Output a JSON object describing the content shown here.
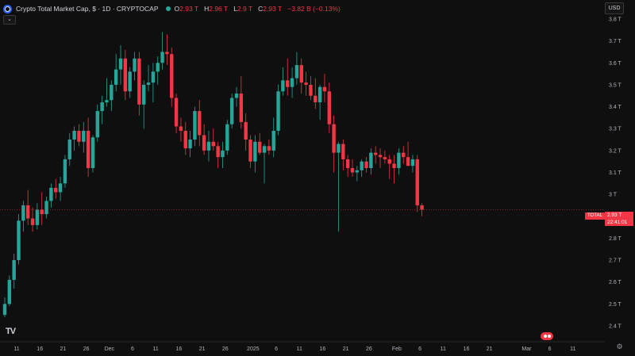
{
  "legend": {
    "symbol_title": "Crypto Total Market Cap, $ · 1D · CRYPTOCAP",
    "open_key": "O",
    "open": "2.93 T",
    "high_key": "H",
    "high": "2.96 T",
    "low_key": "L",
    "low": "2.9 T",
    "close_key": "C",
    "close": "2.93 T",
    "change": "−3.82 B (−0.13%)"
  },
  "collapse_icon": "chevron-down-icon",
  "currency": "USD",
  "price_label": {
    "symbol": "TOTAL",
    "price": "2.93 T",
    "countdown": "22:41:01"
  },
  "brand": "TV",
  "colors": {
    "up": "#26a69a",
    "down": "#f23645",
    "background": "#0f0f0f",
    "text": "#d1d4dc"
  },
  "chart_data": {
    "type": "candlestick",
    "y_ticks": [
      "3.8 T",
      "3.7 T",
      "3.6 T",
      "3.5 T",
      "3.4 T",
      "3.3 T",
      "3.2 T",
      "3.1 T",
      "3 T",
      "2.9 T",
      "2.8 T",
      "2.7 T",
      "2.6 T",
      "2.5 T",
      "2.4 T"
    ],
    "y_tick_values": [
      3.8,
      3.7,
      3.6,
      3.5,
      3.4,
      3.3,
      3.2,
      3.1,
      3.0,
      2.9,
      2.8,
      2.7,
      2.6,
      2.5,
      2.4
    ],
    "ylim": [
      2.37,
      3.84
    ],
    "x_labels": [
      "11",
      "16",
      "21",
      "26",
      "Dec",
      "6",
      "11",
      "16",
      "21",
      "26",
      "2025",
      "6",
      "11",
      "16",
      "21",
      "26",
      "Feb",
      "6",
      "11",
      "16",
      "21",
      "Mar",
      "6",
      "11"
    ],
    "x_label_day_index": [
      0,
      5,
      10,
      15,
      20,
      25,
      30,
      35,
      40,
      45,
      51,
      56,
      61,
      66,
      71,
      76,
      82,
      87,
      92,
      97,
      102,
      110,
      115,
      120
    ],
    "last_price": 2.93,
    "candles": [
      [
        2.45,
        2.53,
        2.44,
        2.5
      ],
      [
        2.5,
        2.63,
        2.49,
        2.61
      ],
      [
        2.61,
        2.73,
        2.57,
        2.7
      ],
      [
        2.7,
        2.91,
        2.68,
        2.88
      ],
      [
        2.88,
        2.97,
        2.83,
        2.95
      ],
      [
        2.95,
        3.02,
        2.86,
        2.89
      ],
      [
        2.89,
        2.94,
        2.83,
        2.86
      ],
      [
        2.86,
        2.96,
        2.84,
        2.93
      ],
      [
        2.93,
        3.01,
        2.86,
        2.91
      ],
      [
        2.91,
        2.99,
        2.89,
        2.97
      ],
      [
        2.97,
        3.05,
        2.94,
        3.03
      ],
      [
        3.03,
        3.07,
        2.98,
        3.01
      ],
      [
        3.01,
        3.08,
        2.97,
        3.05
      ],
      [
        3.05,
        3.18,
        3.03,
        3.16
      ],
      [
        3.16,
        3.28,
        3.13,
        3.25
      ],
      [
        3.25,
        3.31,
        3.2,
        3.29
      ],
      [
        3.29,
        3.32,
        3.22,
        3.24
      ],
      [
        3.24,
        3.33,
        3.19,
        3.29
      ],
      [
        3.29,
        3.35,
        3.08,
        3.12
      ],
      [
        3.12,
        3.27,
        3.1,
        3.26
      ],
      [
        3.26,
        3.41,
        3.24,
        3.38
      ],
      [
        3.38,
        3.45,
        3.32,
        3.42
      ],
      [
        3.42,
        3.53,
        3.4,
        3.43
      ],
      [
        3.43,
        3.52,
        3.38,
        3.5
      ],
      [
        3.5,
        3.64,
        3.47,
        3.57
      ],
      [
        3.57,
        3.68,
        3.5,
        3.62
      ],
      [
        3.62,
        3.66,
        3.43,
        3.47
      ],
      [
        3.47,
        3.58,
        3.44,
        3.56
      ],
      [
        3.56,
        3.65,
        3.52,
        3.62
      ],
      [
        3.62,
        3.65,
        3.36,
        3.41
      ],
      [
        3.41,
        3.52,
        3.3,
        3.5
      ],
      [
        3.5,
        3.59,
        3.47,
        3.51
      ],
      [
        3.51,
        3.6,
        3.42,
        3.56
      ],
      [
        3.56,
        3.63,
        3.5,
        3.6
      ],
      [
        3.6,
        3.74,
        3.57,
        3.65
      ],
      [
        3.65,
        3.73,
        3.59,
        3.64
      ],
      [
        3.64,
        3.67,
        3.4,
        3.44
      ],
      [
        3.44,
        3.46,
        3.28,
        3.31
      ],
      [
        3.31,
        3.35,
        3.24,
        3.29
      ],
      [
        3.29,
        3.33,
        3.18,
        3.21
      ],
      [
        3.21,
        3.29,
        3.17,
        3.25
      ],
      [
        3.25,
        3.4,
        3.22,
        3.38
      ],
      [
        3.38,
        3.43,
        3.22,
        3.27
      ],
      [
        3.27,
        3.32,
        3.18,
        3.2
      ],
      [
        3.2,
        3.29,
        3.15,
        3.24
      ],
      [
        3.24,
        3.3,
        3.2,
        3.22
      ],
      [
        3.22,
        3.24,
        3.12,
        3.17
      ],
      [
        3.17,
        3.24,
        3.12,
        3.2
      ],
      [
        3.2,
        3.34,
        3.18,
        3.32
      ],
      [
        3.32,
        3.46,
        3.3,
        3.44
      ],
      [
        3.44,
        3.49,
        3.4,
        3.46
      ],
      [
        3.46,
        3.54,
        3.3,
        3.33
      ],
      [
        3.33,
        3.37,
        3.2,
        3.25
      ],
      [
        3.25,
        3.27,
        3.12,
        3.15
      ],
      [
        3.15,
        3.27,
        3.1,
        3.24
      ],
      [
        3.24,
        3.28,
        3.18,
        3.19
      ],
      [
        3.19,
        3.23,
        3.05,
        3.22
      ],
      [
        3.22,
        3.25,
        3.18,
        3.2
      ],
      [
        3.2,
        3.35,
        3.17,
        3.29
      ],
      [
        3.29,
        3.5,
        3.27,
        3.47
      ],
      [
        3.47,
        3.58,
        3.45,
        3.52
      ],
      [
        3.52,
        3.62,
        3.45,
        3.49
      ],
      [
        3.49,
        3.58,
        3.44,
        3.53
      ],
      [
        3.53,
        3.65,
        3.5,
        3.59
      ],
      [
        3.59,
        3.62,
        3.46,
        3.51
      ],
      [
        3.51,
        3.56,
        3.45,
        3.5
      ],
      [
        3.5,
        3.54,
        3.43,
        3.45
      ],
      [
        3.45,
        3.53,
        3.39,
        3.42
      ],
      [
        3.42,
        3.5,
        3.34,
        3.49
      ],
      [
        3.49,
        3.55,
        3.42,
        3.47
      ],
      [
        3.47,
        3.51,
        3.28,
        3.32
      ],
      [
        3.32,
        3.36,
        3.1,
        3.19
      ],
      [
        3.19,
        3.24,
        2.83,
        3.23
      ],
      [
        3.23,
        3.25,
        3.11,
        3.16
      ],
      [
        3.16,
        3.18,
        3.08,
        3.12
      ],
      [
        3.12,
        3.16,
        3.08,
        3.1
      ],
      [
        3.1,
        3.13,
        3.06,
        3.11
      ],
      [
        3.11,
        3.16,
        3.08,
        3.15
      ],
      [
        3.15,
        3.17,
        3.1,
        3.12
      ],
      [
        3.12,
        3.21,
        3.09,
        3.19
      ],
      [
        3.19,
        3.22,
        3.14,
        3.18
      ],
      [
        3.18,
        3.21,
        3.12,
        3.17
      ],
      [
        3.17,
        3.2,
        3.14,
        3.16
      ],
      [
        3.16,
        3.18,
        3.07,
        3.14
      ],
      [
        3.14,
        3.18,
        3.05,
        3.12
      ],
      [
        3.12,
        3.21,
        3.09,
        3.19
      ],
      [
        3.19,
        3.22,
        3.14,
        3.17
      ],
      [
        3.17,
        3.24,
        3.13,
        3.13
      ],
      [
        3.13,
        3.18,
        3.1,
        3.16
      ],
      [
        3.16,
        3.18,
        2.92,
        2.95
      ],
      [
        2.95,
        2.96,
        2.9,
        2.93
      ]
    ]
  }
}
